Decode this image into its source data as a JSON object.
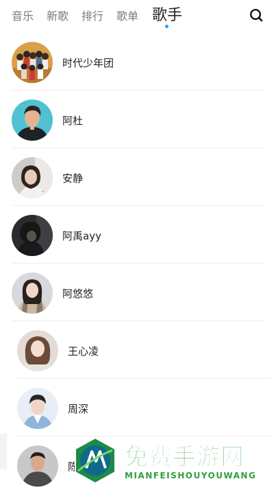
{
  "tabs": [
    {
      "label": "音乐",
      "active": false
    },
    {
      "label": "新歌",
      "active": false
    },
    {
      "label": "排行",
      "active": false
    },
    {
      "label": "歌单",
      "active": false
    },
    {
      "label": "歌手",
      "active": true
    }
  ],
  "search": {
    "icon": "search-icon"
  },
  "singers": [
    {
      "name": "时代少年团"
    },
    {
      "name": "阿杜"
    },
    {
      "name": "安静"
    },
    {
      "name": "阿禹ayy"
    },
    {
      "name": "阿悠悠"
    },
    {
      "name": "王心凌"
    },
    {
      "name": "周深"
    },
    {
      "name": "陈奕迅"
    }
  ],
  "watermark": {
    "title": "免费手游网",
    "subtitle": "MIANFEISHOUYOUWANG"
  },
  "colors": {
    "accent": "#1e9fff",
    "watermark_green": "#2d9f3e"
  }
}
